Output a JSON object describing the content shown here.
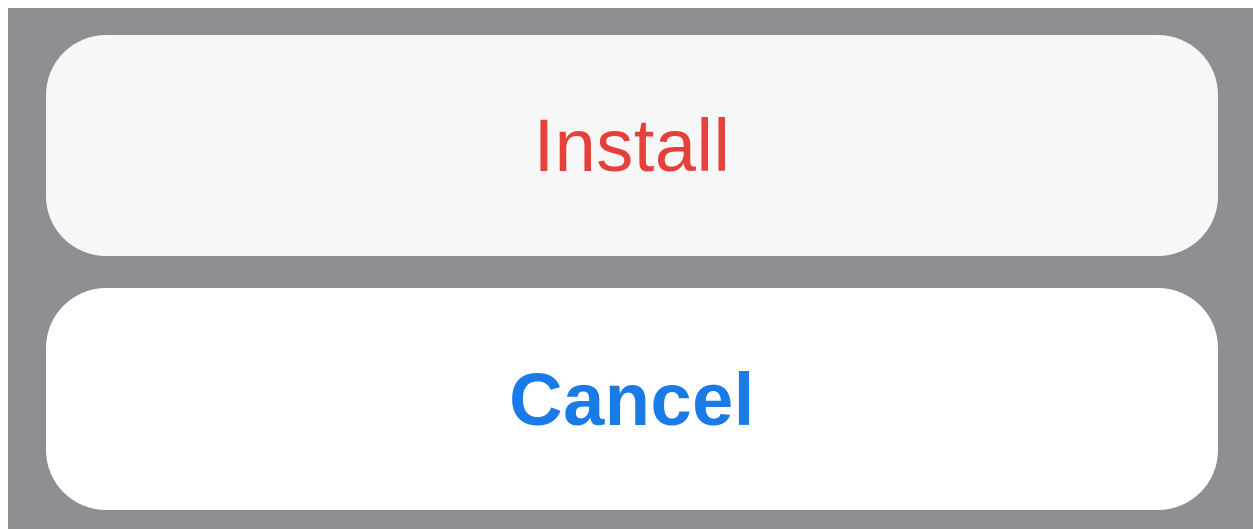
{
  "action_sheet": {
    "install_label": "Install",
    "cancel_label": "Cancel"
  },
  "colors": {
    "destructive": "#e5413a",
    "accent": "#1a7be6",
    "overlay": "#8e8e93"
  }
}
